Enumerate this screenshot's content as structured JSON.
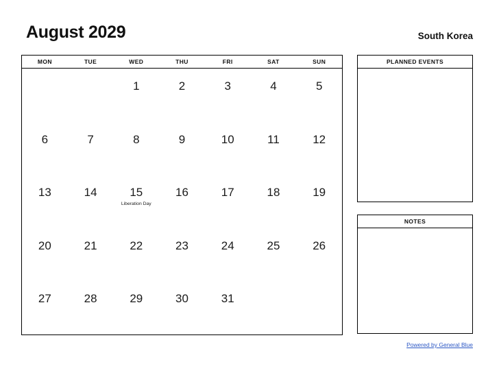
{
  "header": {
    "title": "August 2029",
    "country": "South Korea"
  },
  "calendar": {
    "weekdays": [
      "MON",
      "TUE",
      "WED",
      "THU",
      "FRI",
      "SAT",
      "SUN"
    ],
    "weeks": [
      [
        {
          "day": ""
        },
        {
          "day": ""
        },
        {
          "day": "1"
        },
        {
          "day": "2"
        },
        {
          "day": "3"
        },
        {
          "day": "4"
        },
        {
          "day": "5"
        }
      ],
      [
        {
          "day": "6"
        },
        {
          "day": "7"
        },
        {
          "day": "8"
        },
        {
          "day": "9"
        },
        {
          "day": "10"
        },
        {
          "day": "11"
        },
        {
          "day": "12"
        }
      ],
      [
        {
          "day": "13"
        },
        {
          "day": "14"
        },
        {
          "day": "15",
          "event": "Liberation Day"
        },
        {
          "day": "16"
        },
        {
          "day": "17"
        },
        {
          "day": "18"
        },
        {
          "day": "19"
        }
      ],
      [
        {
          "day": "20"
        },
        {
          "day": "21"
        },
        {
          "day": "22"
        },
        {
          "day": "23"
        },
        {
          "day": "24"
        },
        {
          "day": "25"
        },
        {
          "day": "26"
        }
      ],
      [
        {
          "day": "27"
        },
        {
          "day": "28"
        },
        {
          "day": "29"
        },
        {
          "day": "30"
        },
        {
          "day": "31"
        },
        {
          "day": ""
        },
        {
          "day": ""
        }
      ]
    ]
  },
  "side_panels": [
    {
      "title": "PLANNED EVENTS",
      "body": ""
    },
    {
      "title": "NOTES",
      "body": ""
    }
  ],
  "footer": {
    "link_text": "Powered by General Blue"
  },
  "colors": {
    "link": "#2b57c4",
    "border": "#000000",
    "text": "#1a1a1a",
    "background": "#ffffff"
  }
}
